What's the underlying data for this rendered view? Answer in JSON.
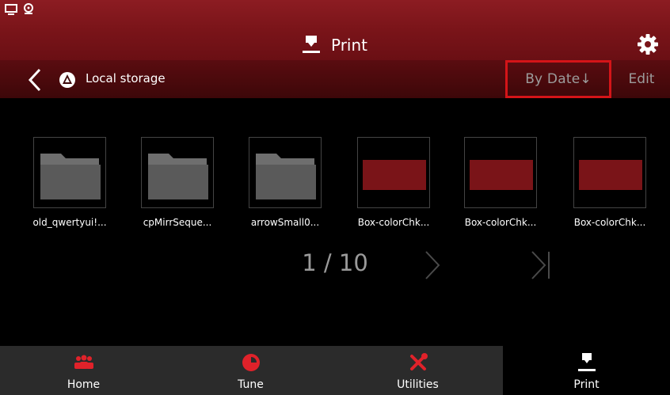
{
  "header": {
    "title": "Print"
  },
  "nav": {
    "storage_label": "Local storage",
    "sort_label": "By Date↓",
    "edit_label": "Edit"
  },
  "files": [
    {
      "name": "old_qwertyui!...",
      "kind": "folder"
    },
    {
      "name": "cpMirrSeque...",
      "kind": "folder"
    },
    {
      "name": "arrowSmall0...",
      "kind": "folder"
    },
    {
      "name": "Box-colorChk...",
      "kind": "model"
    },
    {
      "name": "Box-colorChk...",
      "kind": "model"
    },
    {
      "name": "Box-colorChk...",
      "kind": "model"
    }
  ],
  "pager": {
    "current": "1",
    "total": "10",
    "text": "1 / 10"
  },
  "tabs": [
    {
      "label": "Home",
      "icon": "users-icon"
    },
    {
      "label": "Tune",
      "icon": "pie-icon"
    },
    {
      "label": "Utilities",
      "icon": "tools-icon"
    },
    {
      "label": "Print",
      "icon": "print-icon",
      "active": true
    }
  ],
  "colors": {
    "accent": "#d41418",
    "header": "#7a1419",
    "model_thumb": "#7a1418",
    "tab_icon": "#e0222a"
  }
}
